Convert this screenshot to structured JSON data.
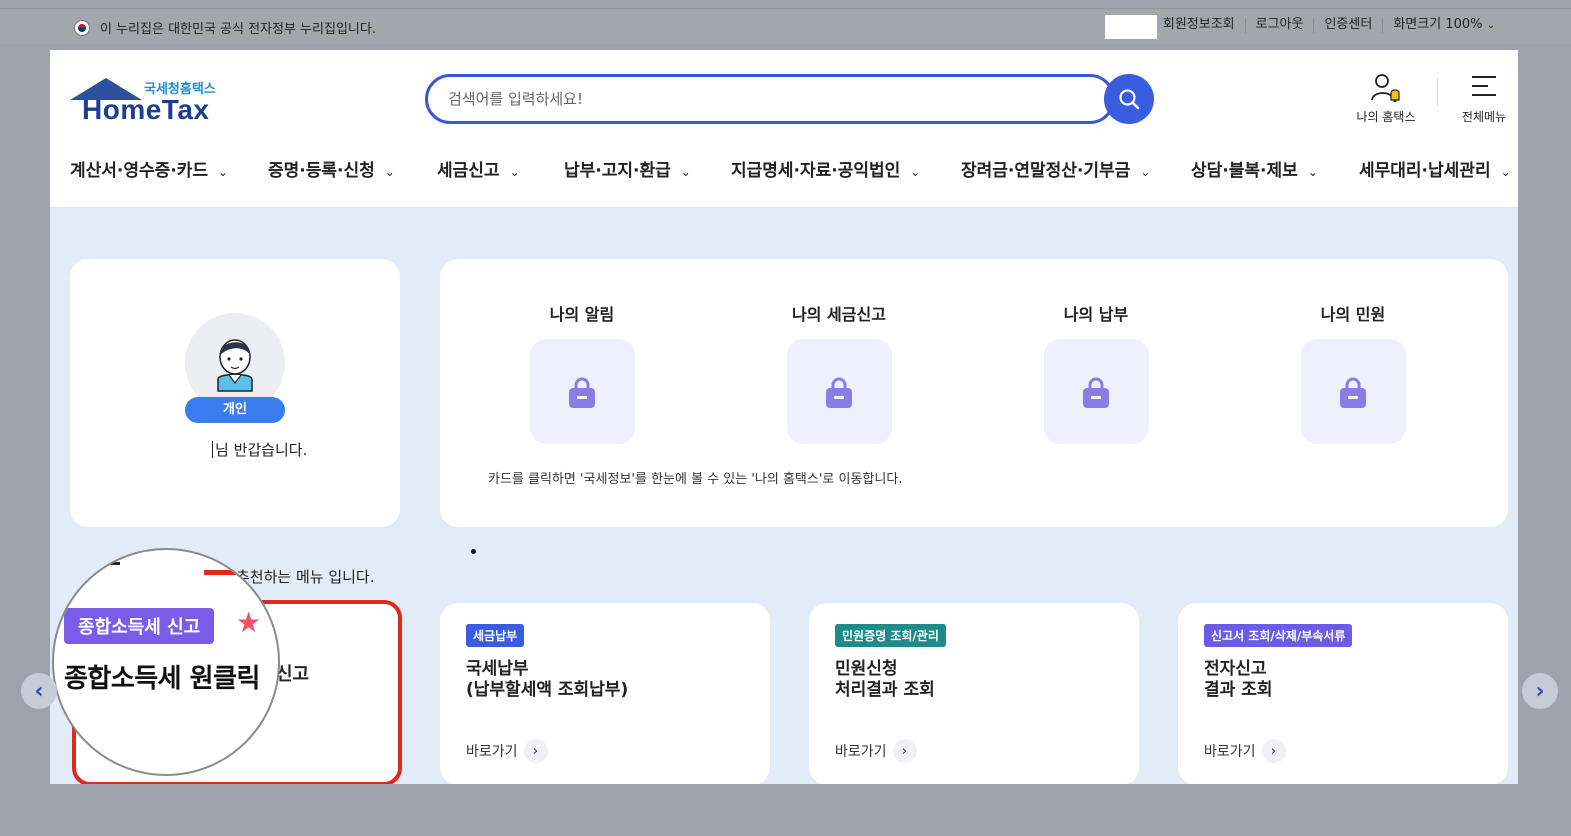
{
  "gov_bar": {
    "text": "이 누리집은 대한민국 공식 전자정부 누리집입니다.",
    "links": [
      "회원정보조회",
      "로그아웃",
      "인증센터"
    ],
    "zoom_label": "화면크기",
    "zoom_value": "100%"
  },
  "header": {
    "logo_sub": "국세청홈택스",
    "logo_main": "HomeTax",
    "search_placeholder": "검색어를 입력하세요!",
    "my_hometax": "나의 홈택스",
    "all_menu": "전체메뉴"
  },
  "gnb": [
    {
      "label": "계산서·영수증·카드"
    },
    {
      "label": "증명·등록·신청"
    },
    {
      "label": "세금신고"
    },
    {
      "label": "납부·고지·환급"
    },
    {
      "label": "지급명세·자료·공익법인"
    },
    {
      "label": "장려금·연말정산·기부금"
    },
    {
      "label": "상담·불복·제보"
    },
    {
      "label": "세무대리·납세관리"
    }
  ],
  "profile": {
    "badge": "개인",
    "greeting": "님 반갑습니다."
  },
  "status": {
    "items": [
      "나의 알림",
      "나의 세금신고",
      "나의 납부",
      "나의 민원"
    ],
    "note": "카드를 클릭하면 '국세정보'를 한눈에 볼 수 있는 '나의 홈택스'로 이동합니다."
  },
  "recommend_text": "추천하는 메뉴 입니다.",
  "highlight": {
    "tag": "종합소득세 신고",
    "title": "종합소득세 원클릭",
    "partial_title": "신고"
  },
  "menu_cards": [
    {
      "tag": "세금납부",
      "tag_color": "#3a5ce0",
      "title": "국세납부\n(납부할세액 조회납부)",
      "link": "바로가기"
    },
    {
      "tag": "민원증명 조회/관리",
      "tag_color": "#1f8a8a",
      "title": "민원신청\n처리결과 조회",
      "link": "바로가기"
    },
    {
      "tag": "신고서 조회/삭제/부속서류",
      "tag_color": "#6a5ce8",
      "title": "전자신고\n결과 조회",
      "link": "바로가기"
    }
  ],
  "colors": {
    "primary": "#3a5ce0",
    "highlight_border": "#e0281c",
    "lock": "#8a7be8"
  }
}
